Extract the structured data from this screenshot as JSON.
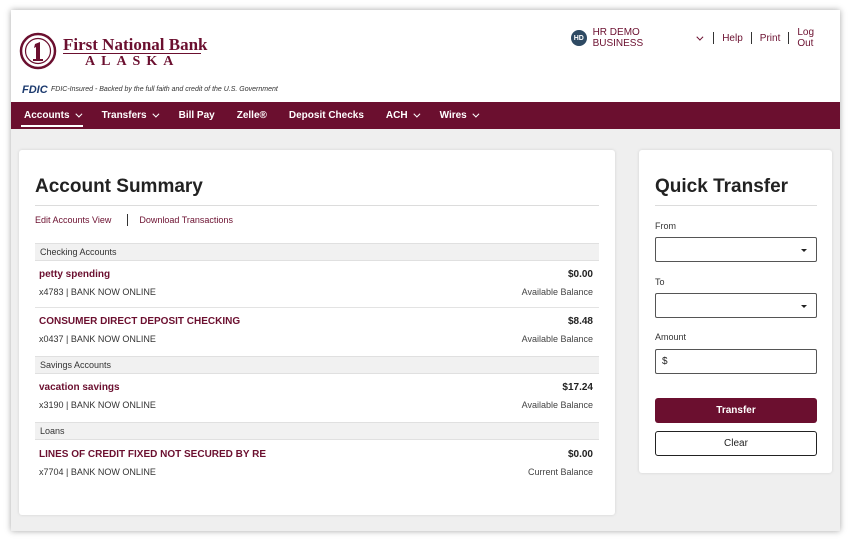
{
  "brand": {
    "name_line1": "First National Bank",
    "name_line2": "ALASKA",
    "fdic_mark": "FDIC",
    "fdic_text": "FDIC-Insured - Backed by the full faith and credit of the U.S. Government",
    "color": "#6b0f2f"
  },
  "user_menu": {
    "avatar_initials": "HD",
    "business_name": "HR DEMO BUSINESS",
    "links": [
      "Help",
      "Print",
      "Log Out"
    ]
  },
  "nav": {
    "items": [
      {
        "label": "Accounts",
        "dropdown": true,
        "active": true
      },
      {
        "label": "Transfers",
        "dropdown": true
      },
      {
        "label": "Bill Pay",
        "dropdown": false
      },
      {
        "label": "Zelle®",
        "dropdown": false
      },
      {
        "label": "Deposit Checks",
        "dropdown": false
      },
      {
        "label": "ACH",
        "dropdown": true
      },
      {
        "label": "Wires",
        "dropdown": true
      }
    ]
  },
  "summary": {
    "title": "Account Summary",
    "links": [
      "Edit Accounts View",
      "Download Transactions"
    ],
    "sections": [
      {
        "heading": "Checking Accounts"
      },
      {
        "heading": "Savings Accounts"
      },
      {
        "heading": "Loans"
      }
    ],
    "accounts": [
      {
        "name": "petty spending",
        "number": "x4783 | BANK NOW ONLINE",
        "amount": "$0.00",
        "balance_label": "Available Balance"
      },
      {
        "name": "CONSUMER DIRECT DEPOSIT CHECKING",
        "number": "x0437 | BANK NOW ONLINE",
        "amount": "$8.48",
        "balance_label": "Available Balance"
      },
      {
        "name": "vacation savings",
        "number": "x3190 | BANK NOW ONLINE",
        "amount": "$17.24",
        "balance_label": "Available Balance"
      },
      {
        "name": "LINES OF CREDIT FIXED NOT SECURED BY RE",
        "number": "x7704 | BANK NOW ONLINE",
        "amount": "$0.00",
        "balance_label": "Current Balance"
      }
    ]
  },
  "quick_transfer": {
    "title": "Quick Transfer",
    "from_label": "From",
    "from_value": "",
    "to_label": "To",
    "to_value": "",
    "amount_label": "Amount",
    "amount_value": "$",
    "transfer_button": "Transfer",
    "clear_button": "Clear"
  }
}
